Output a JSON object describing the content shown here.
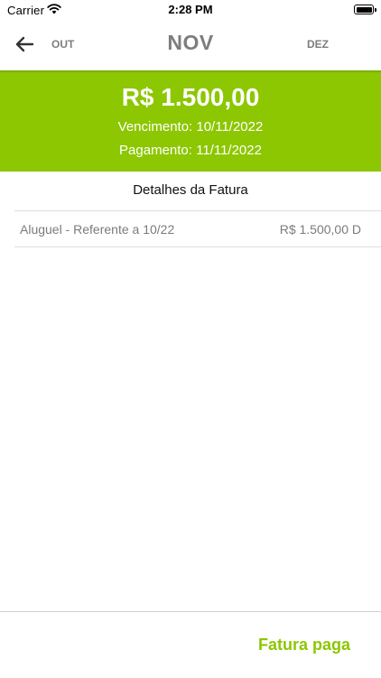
{
  "status_bar": {
    "carrier": "Carrier",
    "time": "2:28 PM"
  },
  "month_nav": {
    "back_icon": "arrow-left-icon",
    "previous": "OUT",
    "current": "NOV",
    "next": "DEZ"
  },
  "summary": {
    "amount": "R$ 1.500,00",
    "due_date": "Vencimento: 10/11/2022",
    "payment_date": "Pagamento: 11/11/2022",
    "background_color": "#8cc702"
  },
  "details": {
    "title": "Detalhes da Fatura",
    "items": [
      {
        "description": "Aluguel - Referente a 10/22",
        "amount": "R$ 1.500,00 D"
      }
    ]
  },
  "footer": {
    "status": "Fatura paga",
    "status_color": "#8cc702"
  }
}
